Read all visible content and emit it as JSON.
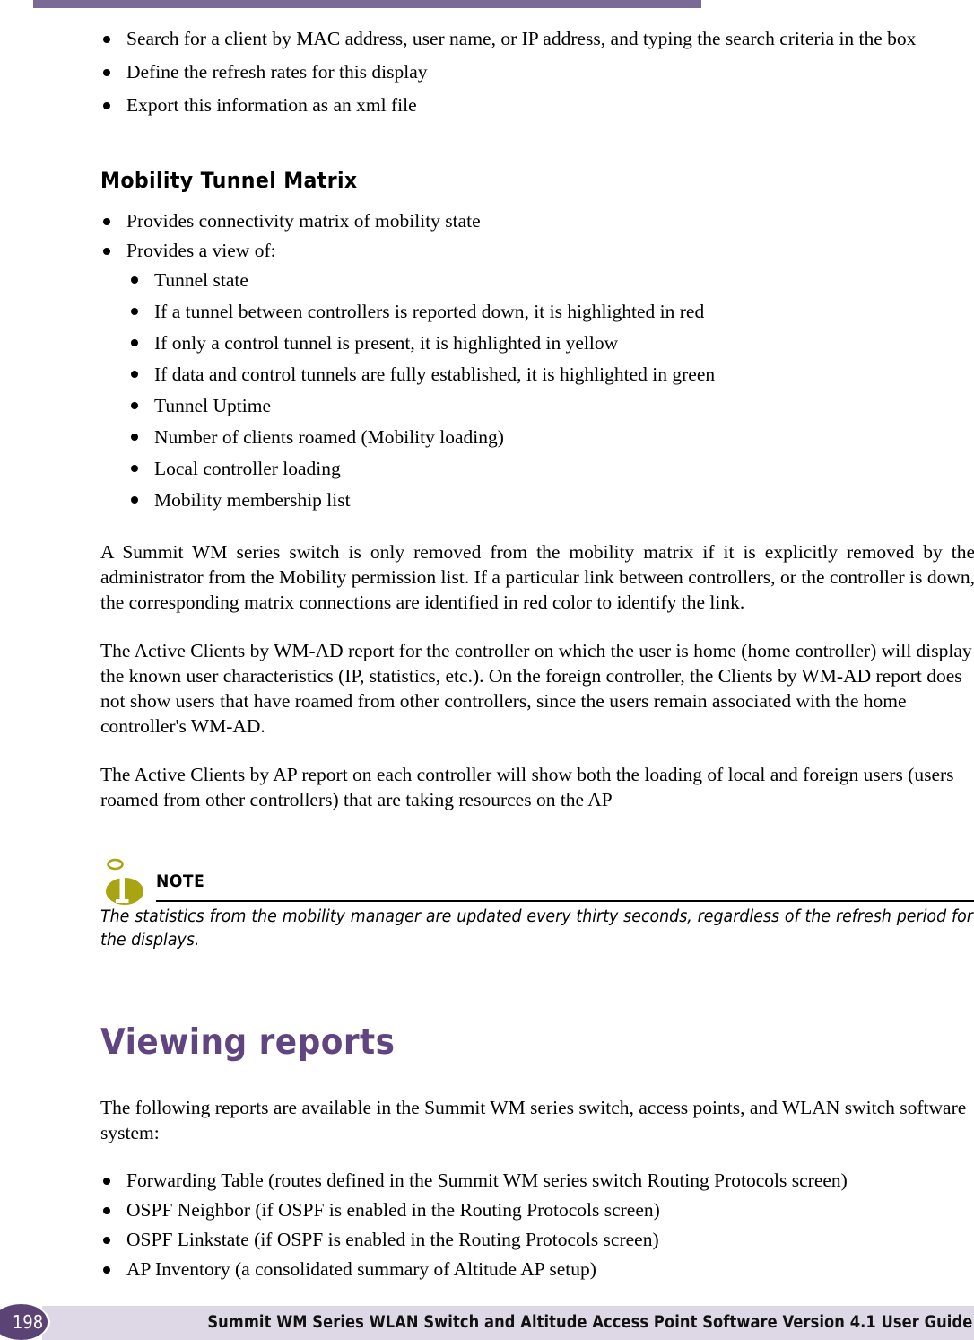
{
  "document": {
    "title": "Summit WM Series WLAN Switch and Altitude Access Point Software Version 4.1 User Guide",
    "page_number": "198"
  },
  "colors": {
    "top_rule": "#7b6a97",
    "chapter_heading": "#614580",
    "footer_bar": "#ded8e6",
    "footer_circle": "#5b4376",
    "note_icon": "#a9a512"
  },
  "intro_bullets": [
    "Search for a client by MAC address, user name, or IP address, and typing the search criteria in the box",
    "Define the refresh rates for this display",
    "Export this information as an xml file"
  ],
  "mobility_section": {
    "heading": "Mobility Tunnel Matrix",
    "bullets": [
      "Provides connectivity matrix of mobility state",
      "Provides a view of:"
    ],
    "sub_bullets": [
      "Tunnel state",
      "If a tunnel between controllers is reported down, it is highlighted in red",
      "If only a control tunnel is present, it is highlighted in yellow",
      "If data and control tunnels are fully established, it is highlighted in green",
      "Tunnel Uptime",
      "Number of clients roamed (Mobility loading)",
      "Local controller loading",
      "Mobility membership list"
    ],
    "paragraphs": [
      "A Summit WM series switch is only removed from the mobility matrix if it is explicitly removed by the administrator from the Mobility permission list. If a particular link between controllers, or the controller is down, the corresponding matrix connections are identified in red color to identify the link.",
      "The Active Clients by WM-AD report for the controller on which the user is home (home controller) will display the known user characteristics (IP, statistics, etc.). On the foreign controller, the Clients by WM-AD report does not show users that have roamed from other controllers, since the users remain associated with the home controller's WM-AD.",
      "The Active Clients by AP report on each controller will show both the loading of local and foreign users (users roamed from other controllers) that are taking resources on the AP"
    ]
  },
  "note": {
    "label": "NOTE",
    "body": "The statistics from the mobility manager are updated every thirty seconds, regardless of the refresh period for the displays."
  },
  "viewing_reports": {
    "heading": "Viewing reports",
    "intro": "The following reports are available in the Summit WM series switch, access points, and WLAN switch software system:",
    "bullets": [
      "Forwarding Table (routes defined in the Summit WM series switch Routing Protocols screen)",
      "OSPF Neighbor (if OSPF is enabled in the Routing Protocols screen)",
      "OSPF Linkstate (if OSPF is enabled in the Routing Protocols screen)",
      "AP Inventory (a consolidated summary of Altitude AP setup)"
    ]
  }
}
